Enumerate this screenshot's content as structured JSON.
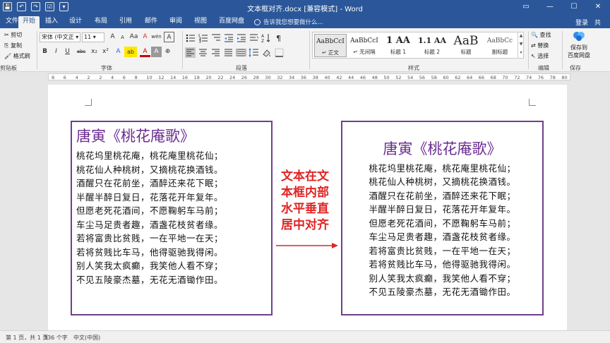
{
  "title_bar": {
    "title": "文本框对齐.docx [兼容模式] - Word",
    "quick_access": [
      "💾",
      "↶",
      "↷",
      "☑",
      "▾"
    ],
    "controls": [
      "▭",
      "—",
      "☐",
      "✕"
    ]
  },
  "tabs": [
    "文件",
    "开始",
    "插入",
    "设计",
    "布局",
    "引用",
    "邮件",
    "审阅",
    "视图",
    "百度网盘"
  ],
  "tell_me": "告诉我您想要做什么...",
  "login": "登录",
  "share": "共",
  "ribbon": {
    "clipboard": {
      "cut": "剪切",
      "copy": "复制",
      "format_painter": "格式刷",
      "label": "剪贴板"
    },
    "font": {
      "font_name": "宋体 (中文正 ▾",
      "font_size": "11 ▾",
      "grow": "A",
      "shrink": "A",
      "case": "Aa",
      "clear": "A",
      "pinyin": "wén",
      "border": "A",
      "bold": "B",
      "italic": "I",
      "underline": "U",
      "strike": "abc",
      "sub": "x₂",
      "sup": "x²",
      "effects": "A",
      "highlight": "ab",
      "color": "A",
      "shade": "A",
      "circle": "⊕",
      "label": "字体"
    },
    "paragraph": {
      "label": "段落"
    },
    "styles": {
      "items": [
        {
          "sample": "AaBbCcI",
          "name": "↵ 正文"
        },
        {
          "sample": "AaBbCcI",
          "name": "↵ 无间隔"
        },
        {
          "sample": "1 AA",
          "name": "标题 1"
        },
        {
          "sample": "1.1 AA",
          "name": "标题 2"
        },
        {
          "sample": "AaB",
          "name": "标题"
        },
        {
          "sample": "AaBbCc",
          "name": "副标题"
        }
      ],
      "label": "样式"
    },
    "editing": {
      "find": "查找",
      "replace": "替换",
      "select": "选择",
      "label": "编辑"
    },
    "save": {
      "line1": "保存到",
      "line2": "百度网盘",
      "label": "保存"
    }
  },
  "ruler_numbers": [
    "8",
    "6",
    "4",
    "2",
    "2",
    "4",
    "6",
    "8",
    "10",
    "12",
    "14",
    "16",
    "18",
    "20",
    "22",
    "24",
    "26",
    "28",
    "30",
    "32",
    "34",
    "36",
    "38",
    "40",
    "42",
    "44",
    "46",
    "48",
    "50",
    "52",
    "54",
    "56",
    "58",
    "60",
    "62",
    "64",
    "66",
    "68",
    "70",
    "72",
    "74",
    "76",
    "78",
    "80"
  ],
  "poem": {
    "title": "唐寅《桃花庵歌》",
    "lines": [
      "桃花坞里桃花庵，桃花庵里桃花仙；",
      "桃花仙人种桃树，又摘桃花换酒钱。",
      "酒醒只在花前坐，酒醉还来花下眠；",
      "半醒半醉日复日，花落花开年复年。",
      "但愿老死花酒间，不愿鞠躬车马前；",
      "车尘马足贵者趣，酒盏花枝贫者缘。",
      "若将富贵比贫贱，一在平地一在天；",
      "若将贫贱比车马，他得驱驰我得闲。",
      "别人笑我太疯癫，我笑他人看不穿；",
      "不见五陵豪杰墓，无花无酒锄作田。"
    ]
  },
  "note": {
    "lines": [
      "文本在文",
      "本框内部",
      "水平垂直",
      "居中对齐"
    ],
    "color": "#e02424"
  },
  "status": {
    "page": "第 1 页，共 1 页",
    "words": "336 个字",
    "language": "中文(中国)"
  },
  "colors": {
    "title_bar": "#2b579a",
    "textbox_border": "#6f3f8c",
    "poem_title": "#6b2c91"
  }
}
